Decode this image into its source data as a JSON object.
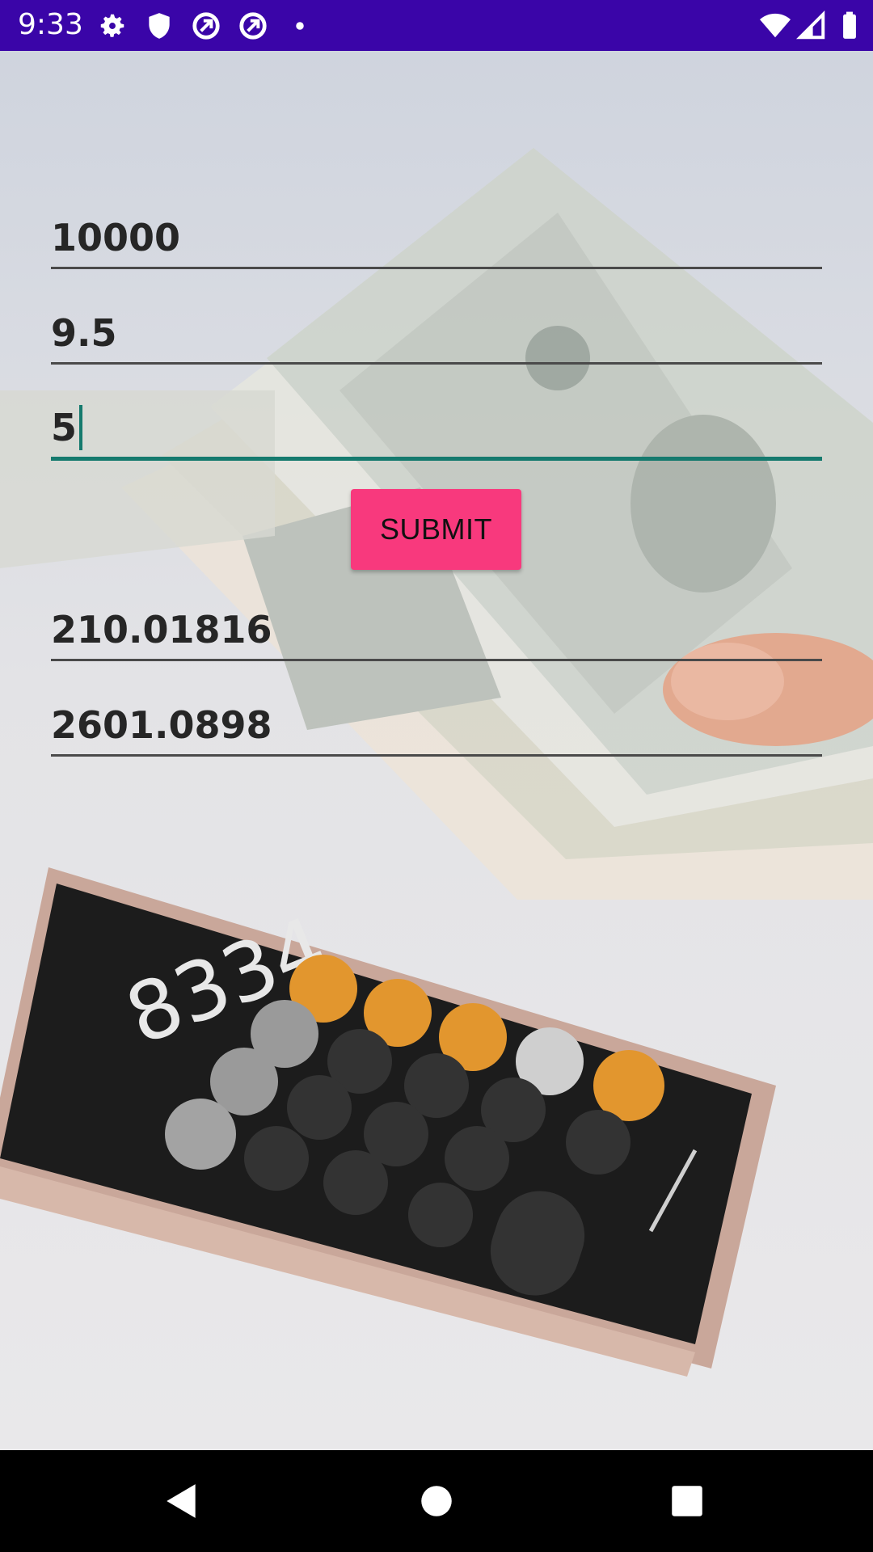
{
  "status_bar": {
    "time": "9:33",
    "icons": [
      "settings-icon",
      "shield-icon",
      "vpn-icon",
      "vpn-icon",
      "dot-icon",
      "wifi-icon",
      "signal-icon",
      "battery-icon"
    ],
    "color": "#3a05a8"
  },
  "form": {
    "principal_value": "10000",
    "rate_value": "9.5",
    "years_value": "5",
    "submit_label": "SUBMIT",
    "submit_color": "#f8397d",
    "focus_color": "#157a6e"
  },
  "results": {
    "monthly_value": "210.01816",
    "total_value": "2601.0898"
  },
  "nav_bar": {
    "icons": [
      "back-icon",
      "home-icon",
      "recents-icon"
    ]
  }
}
